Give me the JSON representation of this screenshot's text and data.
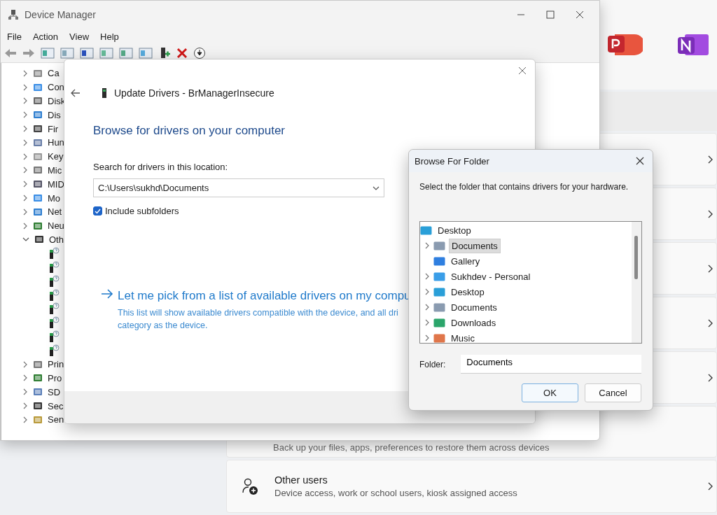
{
  "settings": {
    "backup_description": "Back up your files, apps, preferences to restore them across devices",
    "other_users": {
      "title": "Other users",
      "description": "Device access, work or school users, kiosk assigned access"
    }
  },
  "device_manager": {
    "title": "Device Manager",
    "menu": [
      "File",
      "Action",
      "View",
      "Help"
    ],
    "tree": [
      {
        "label": "Ca",
        "expanded": false
      },
      {
        "label": "Con",
        "expanded": false
      },
      {
        "label": "Disk",
        "expanded": false
      },
      {
        "label": "Dis",
        "expanded": false
      },
      {
        "label": "Fir",
        "expanded": false
      },
      {
        "label": "Hun",
        "expanded": false
      },
      {
        "label": "Key",
        "expanded": false
      },
      {
        "label": "Mic",
        "expanded": false
      },
      {
        "label": "MID",
        "expanded": false
      },
      {
        "label": "Mo",
        "expanded": false
      },
      {
        "label": "Net",
        "expanded": false
      },
      {
        "label": "Neu",
        "expanded": false
      },
      {
        "label": "Oth",
        "expanded": true,
        "children": [
          {
            "kind": "unknown-device"
          },
          {
            "kind": "unknown-device"
          },
          {
            "kind": "unknown-device"
          },
          {
            "kind": "unknown-device"
          },
          {
            "kind": "unknown-device"
          },
          {
            "kind": "unknown-device"
          },
          {
            "kind": "unknown-device"
          },
          {
            "kind": "unknown-device"
          }
        ]
      },
      {
        "label": "Prin",
        "expanded": false
      },
      {
        "label": "Pro",
        "expanded": false
      },
      {
        "label": "SD",
        "expanded": false
      },
      {
        "label": "Sec",
        "expanded": false
      },
      {
        "label": "Sen",
        "expanded": false
      }
    ]
  },
  "update_dialog": {
    "title": "Update Drivers - BrManagerInsecure",
    "heading": "Browse for drivers on your computer",
    "location_label": "Search for drivers in this location:",
    "location_value": "C:\\Users\\sukhd\\Documents",
    "include_subfolders": {
      "label": "Include subfolders",
      "checked": true
    },
    "link": {
      "title": "Let me pick from a list of available drivers on my compu",
      "description_lines": [
        "This list will show available drivers compatible with the device, and all dri",
        "category as the device."
      ]
    }
  },
  "browse_dialog": {
    "title": "Browse For Folder",
    "instruction": "Select the folder that contains drivers for your hardware.",
    "tree": [
      {
        "label": "Desktop",
        "expandable": false,
        "selected": false,
        "children": [
          {
            "label": "Documents",
            "expandable": true,
            "selected": true
          },
          {
            "label": "Gallery",
            "expandable": false,
            "selected": false
          },
          {
            "label": "Sukhdev - Personal",
            "expandable": true,
            "selected": false
          },
          {
            "label": "Desktop",
            "expandable": true,
            "selected": false
          },
          {
            "label": "Documents",
            "expandable": true,
            "selected": false
          },
          {
            "label": "Downloads",
            "expandable": true,
            "selected": false
          },
          {
            "label": "Music",
            "expandable": true,
            "selected": false
          }
        ]
      }
    ],
    "folder_label": "Folder:",
    "folder_value": "Documents",
    "buttons": [
      {
        "label": "OK",
        "default": true
      },
      {
        "label": "Cancel",
        "default": false
      }
    ]
  }
}
